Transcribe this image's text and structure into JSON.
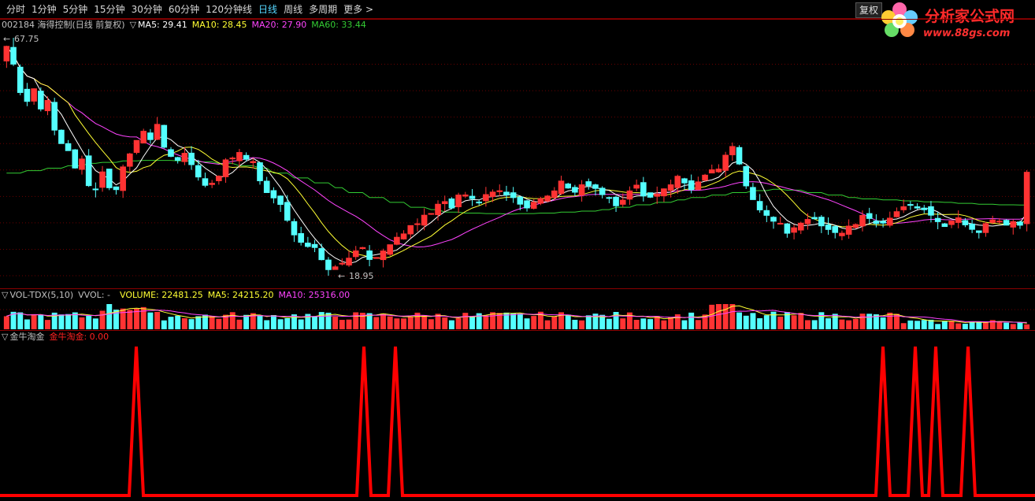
{
  "toolbar": {
    "tabs": [
      "分时",
      "1分钟",
      "5分钟",
      "15分钟",
      "30分钟",
      "60分钟",
      "120分钟线",
      "日线",
      "周线",
      "多周期"
    ],
    "active_tab": "日线",
    "more_label": "更多",
    "more_icon": "chevron-right-icon",
    "fuquan_label": "复权"
  },
  "logo": {
    "title": "分析家公式网",
    "url": "www.88gs.com",
    "icon": "flower-logo-icon"
  },
  "price_panel": {
    "stock": "002184 海得控制(日线 前复权)",
    "toggle_icon": "triangle-down-icon",
    "ma5": "MA5: 29.41",
    "ma10": "MA10: 28.45",
    "ma20": "MA20: 27.90",
    "ma60": "MA60: 33.44",
    "high_label": "67.75",
    "low_label": "18.95",
    "colors": {
      "up": "#ff3333",
      "down": "#54ffff",
      "ma5": "#ffffff",
      "ma10": "#ffff33",
      "ma20": "#ff44ff",
      "ma60": "#33cc33"
    }
  },
  "vol_panel": {
    "name": "VOL-TDX(5,10)",
    "vvol": "VVOL: -",
    "volume": "VOLUME: 22481.25",
    "ma5": "MA5: 24215.20",
    "ma10": "MA10: 25316.00"
  },
  "indicator_panel": {
    "name": "金牛淘金",
    "value": "金牛淘金: 0.00",
    "color": "#ff0000"
  },
  "chart_data": {
    "type": "candlestick",
    "date_axis": "daily, labels not shown",
    "price_range": [
      18.95,
      67.75
    ],
    "high_marker": 67.75,
    "low_marker": 18.95,
    "last_ma": {
      "MA5": 29.41,
      "MA10": 28.45,
      "MA20": 27.9,
      "MA60": 33.44
    },
    "volume_last": {
      "VOLUME": 22481.25,
      "MA5": 24215.2,
      "MA10": 25316.0
    },
    "indicator_last": 0.0
  }
}
